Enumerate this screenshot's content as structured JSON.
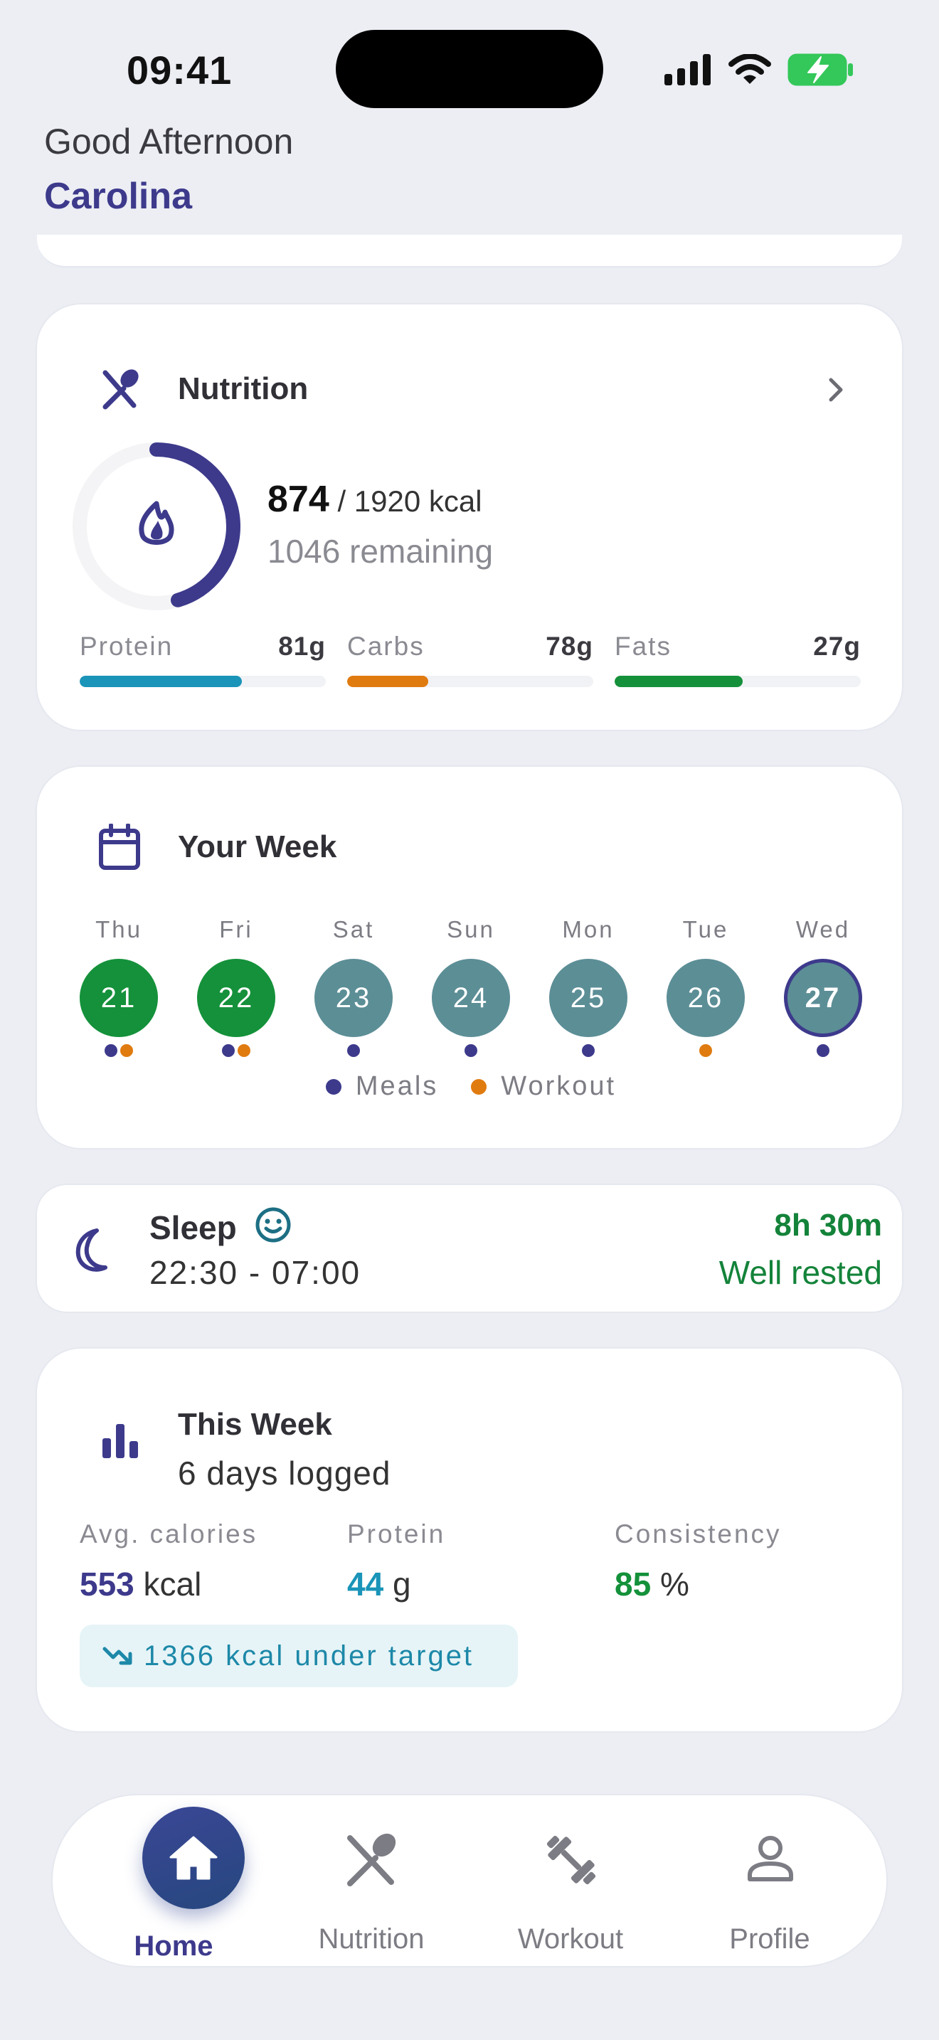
{
  "status_bar": {
    "time": "09:41"
  },
  "greeting": {
    "salutation": "Good Afternoon",
    "name": "Carolina"
  },
  "nutrition": {
    "title": "Nutrition",
    "consumed": "874",
    "target_text": "/ 1920 kcal",
    "remaining_text": "1046 remaining",
    "progress_fraction": 0.455,
    "macros": [
      {
        "label": "Protein",
        "value": "81g",
        "fill_fraction": 0.66,
        "color": "#1a94b8"
      },
      {
        "label": "Carbs",
        "value": "78g",
        "fill_fraction": 0.33,
        "color": "#e07b10"
      },
      {
        "label": "Fats",
        "value": "27g",
        "fill_fraction": 0.52,
        "color": "#14913a"
      }
    ]
  },
  "week": {
    "title": "Your Week",
    "days": [
      {
        "name": "Thu",
        "date": "21",
        "status": "complete",
        "meals": true,
        "workout": true
      },
      {
        "name": "Fri",
        "date": "22",
        "status": "complete",
        "meals": true,
        "workout": true
      },
      {
        "name": "Sat",
        "date": "23",
        "status": "partial",
        "meals": true,
        "workout": false
      },
      {
        "name": "Sun",
        "date": "24",
        "status": "partial",
        "meals": true,
        "workout": false
      },
      {
        "name": "Mon",
        "date": "25",
        "status": "partial",
        "meals": true,
        "workout": false
      },
      {
        "name": "Tue",
        "date": "26",
        "status": "partial",
        "meals": false,
        "workout": true
      },
      {
        "name": "Wed",
        "date": "27",
        "status": "today",
        "meals": true,
        "workout": false
      }
    ],
    "legend": {
      "meals": "Meals",
      "workout": "Workout"
    },
    "colors": {
      "complete": "#14913a",
      "partial": "#5c8e96",
      "today": "#5c8e96",
      "today_ring": "#3d3a8c",
      "meals_dot": "#3d3a8c",
      "workout_dot": "#e07b10"
    }
  },
  "sleep": {
    "title": "Sleep",
    "time_range": "22:30 - 07:00",
    "duration": "8h 30m",
    "quality": "Well rested"
  },
  "this_week": {
    "title": "This Week",
    "subtitle": "6 days logged",
    "stats": [
      {
        "label": "Avg. calories",
        "value": "553",
        "unit": "kcal",
        "color": "#3d3a8c"
      },
      {
        "label": "Protein",
        "value": "44",
        "unit": "g",
        "color": "#1a94b8"
      },
      {
        "label": "Consistency",
        "value": "85",
        "unit": "%",
        "color": "#14913a"
      }
    ],
    "trend_text": "1366 kcal under target"
  },
  "tabbar": {
    "active": "Home",
    "tabs": [
      {
        "label": "Home",
        "icon": "home-icon"
      },
      {
        "label": "Nutrition",
        "icon": "utensils-icon"
      },
      {
        "label": "Workout",
        "icon": "dumbbell-icon"
      },
      {
        "label": "Profile",
        "icon": "user-icon"
      }
    ]
  }
}
